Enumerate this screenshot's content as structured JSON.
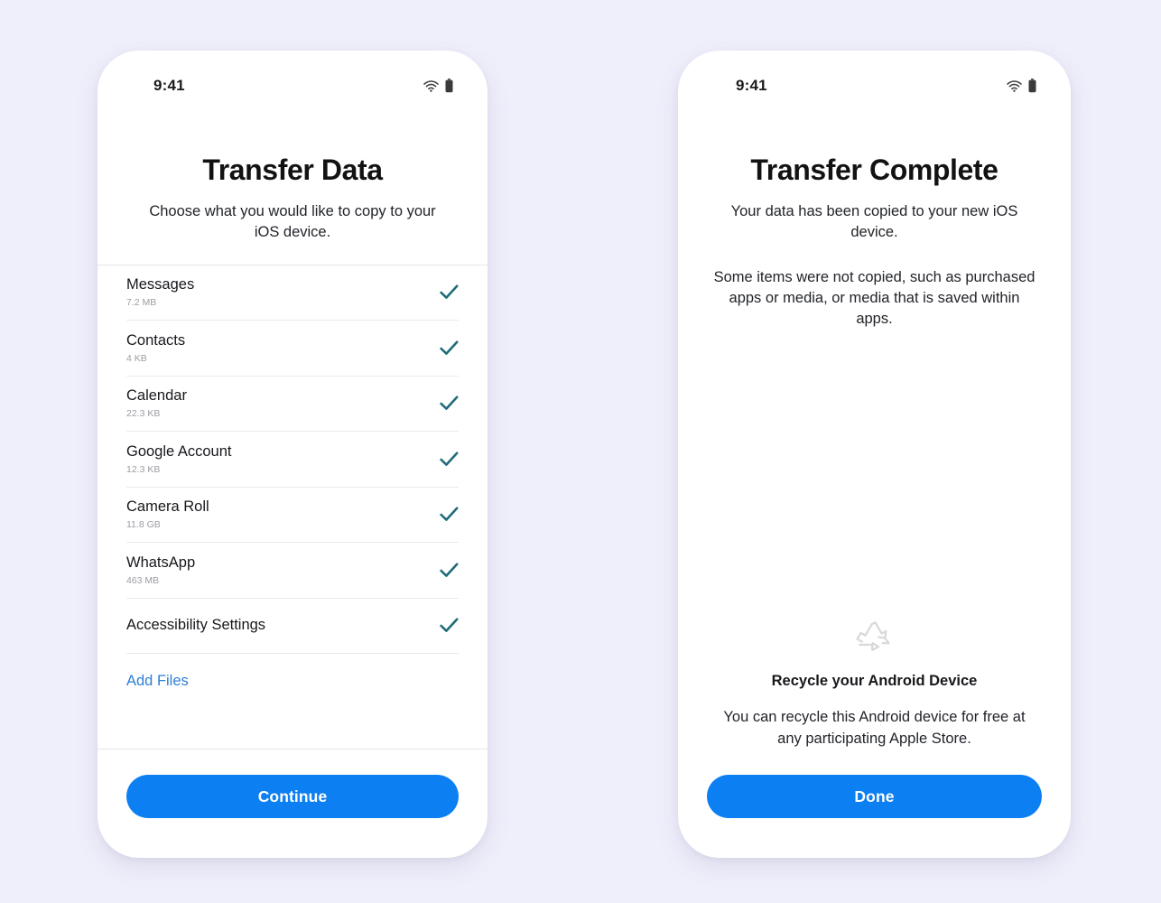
{
  "background_color": "#efeffb",
  "accent_color": "#0c7ff2",
  "link_color": "#2e7fd4",
  "check_color": "#1f6b78",
  "screens": [
    {
      "id": "transfer-data",
      "status_bar": {
        "time": "9:41",
        "icons": [
          "wifi-icon",
          "battery-icon"
        ]
      },
      "title": "Transfer Data",
      "subtitle": "Choose what you would like to copy to your iOS device.",
      "items": [
        {
          "label": "Messages",
          "size": "7.2 MB",
          "checked": true
        },
        {
          "label": "Contacts",
          "size": "4 KB",
          "checked": true
        },
        {
          "label": "Calendar",
          "size": "22.3 KB",
          "checked": true
        },
        {
          "label": "Google Account",
          "size": "12.3 KB",
          "checked": true
        },
        {
          "label": "Camera Roll",
          "size": "11.8 GB",
          "checked": true
        },
        {
          "label": "WhatsApp",
          "size": "463 MB",
          "checked": true
        },
        {
          "label": "Accessibility Settings",
          "size": "",
          "checked": true
        }
      ],
      "add_files_label": "Add Files",
      "cta_label": "Continue"
    },
    {
      "id": "transfer-complete",
      "status_bar": {
        "time": "9:41",
        "icons": [
          "wifi-icon",
          "battery-icon"
        ]
      },
      "title": "Transfer Complete",
      "subtitle": "Your data has been copied to your new iOS device.",
      "subtitle_2": "Some items were not copied, such as purchased apps or media, or media that is saved within apps.",
      "recycle": {
        "icon": "recycle-icon",
        "title": "Recycle your Android Device",
        "description": "You can recycle this Android device for free at any participating Apple Store."
      },
      "cta_label": "Done"
    }
  ]
}
